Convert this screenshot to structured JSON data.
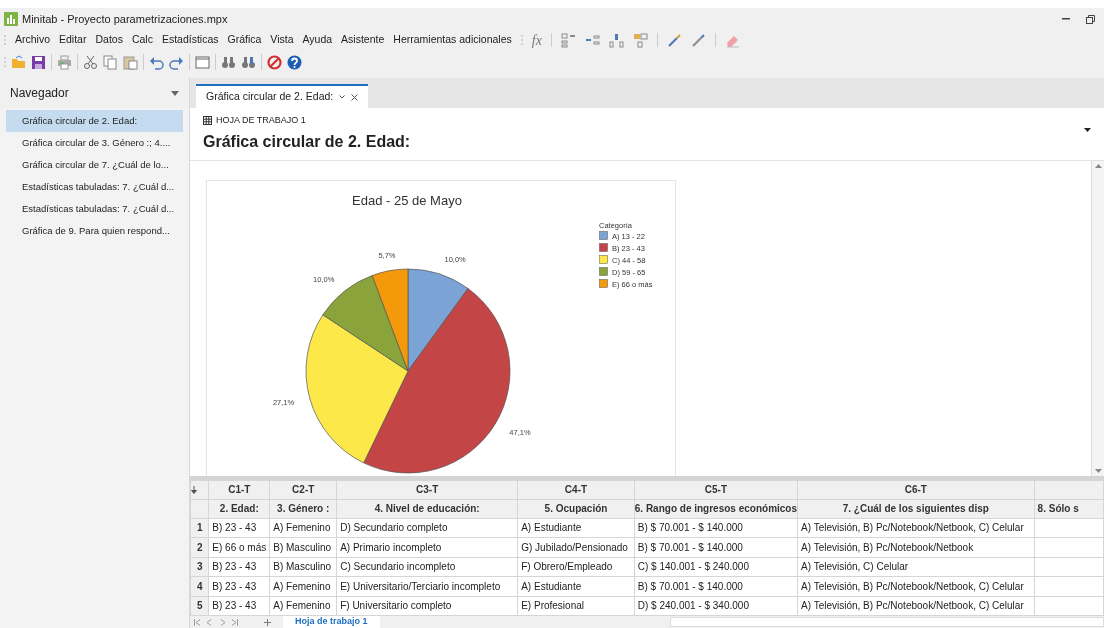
{
  "window": {
    "title": "Minitab - Proyecto parametrizaciones.mpx"
  },
  "menu": [
    "Archivo",
    "Editar",
    "Datos",
    "Calc",
    "Estadísticas",
    "Gráfica",
    "Vista",
    "Ayuda",
    "Asistente",
    "Herramientas adicionales"
  ],
  "formula_button": "fx",
  "navigator": {
    "title": "Navegador",
    "items": [
      {
        "label": "Gráfica circular de 2. Edad:",
        "selected": true
      },
      {
        "label": "Gráfica circular de 3. Género :; 4....",
        "selected": false
      },
      {
        "label": "Gráfica circular de 7. ¿Cuál de lo...",
        "selected": false
      },
      {
        "label": "Estadísticas tabuladas: 7. ¿Cuál d...",
        "selected": false
      },
      {
        "label": "Estadísticas tabuladas: 7. ¿Cuál d...",
        "selected": false
      },
      {
        "label": "Gráfica de 9. Para quien respond...",
        "selected": false
      }
    ]
  },
  "tabs": [
    {
      "label": "Gráfica circular de 2. Edad:",
      "selected": true
    }
  ],
  "output": {
    "worksheet": "HOJA DE TRABAJO 1",
    "title": "Gráfica circular de 2. Edad:",
    "chart_data": {
      "type": "pie",
      "title": "Edad - 25 de Mayo",
      "legend": "right",
      "categories": [
        "A) 13 - 22",
        "B) 23 - 43",
        "C) 44 - 58",
        "D) 59 - 65",
        "E) 66 o más"
      ],
      "colors": [
        "#7ba3d6",
        "#c44545",
        "#fde84a",
        "#8aa33a",
        "#f49a0a"
      ],
      "series": [
        {
          "name": "Categoría",
          "values": [
            10.0,
            47.1,
            27.1,
            10.0,
            5.7
          ]
        }
      ],
      "value_labels": [
        "10,0%",
        "47,1%",
        "27,1%",
        "10,0%",
        "5,7%"
      ]
    }
  },
  "worksheet": {
    "columns": [
      {
        "id": "C1-T",
        "name": "2. Edad:"
      },
      {
        "id": "C2-T",
        "name": "3. Género :"
      },
      {
        "id": "C3-T",
        "name": "4. Nivel de educación:"
      },
      {
        "id": "C4-T",
        "name": "5. Ocupación"
      },
      {
        "id": "C5-T",
        "name": "6. Rango de ingresos económicos"
      },
      {
        "id": "C6-T",
        "name": "7. ¿Cuál de los siguientes disp"
      },
      {
        "name": "8. Sólo s"
      }
    ],
    "rows": [
      {
        "number": "1",
        "cells": [
          "B) 23 - 43",
          "A) Femenino",
          "D) Secundario completo",
          "A) Estudiante",
          "B) $ 70.001 - $ 140.000",
          "A) Televisión, B) Pc/Notebook/Netbook, C) Celular"
        ]
      },
      {
        "number": "2",
        "cells": [
          "E) 66 o más",
          "B) Masculino",
          "A) Primario incompleto",
          "G) Jubilado/Pensionado",
          "B) $ 70.001 - $ 140.000",
          "A) Televisión, B) Pc/Notebook/Netbook"
        ]
      },
      {
        "number": "3",
        "cells": [
          "B) 23 - 43",
          "B) Masculino",
          "C) Secundario incompleto",
          "F) Obrero/Empleado",
          "C) $ 140.001 - $ 240.000",
          "A) Televisión, C) Celular"
        ]
      },
      {
        "number": "4",
        "cells": [
          "B) 23 - 43",
          "A) Femenino",
          "E) Universitario/Terciario incompleto",
          "A) Estudiante",
          "B) $ 70.001 - $ 140.000",
          "A) Televisión, B) Pc/Notebook/Netbook, C) Celular"
        ]
      },
      {
        "number": "5",
        "cells": [
          "B) 23 - 43",
          "A) Femenino",
          "F) Universitario completo",
          "E) Profesional",
          "D) $ 240.001 - $ 340.000",
          "A) Televisión, B) Pc/Notebook/Netbook, C) Celular"
        ]
      }
    ],
    "sheet_tabs": [
      {
        "label": "Hoja de trabajo 1",
        "selected": true
      }
    ]
  }
}
